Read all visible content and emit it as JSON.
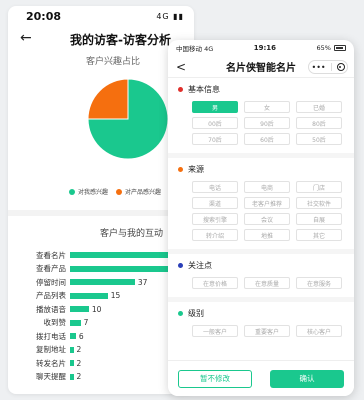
{
  "back_phone": {
    "status": {
      "time": "20:08",
      "signal": "4G"
    },
    "title": "我的访客-访客分析",
    "interest_title": "客户兴趣占比",
    "pie": {
      "slices": [
        {
          "label": "对我感兴趣",
          "value": 75,
          "color": "#1ac88e"
        },
        {
          "label": "对产品感兴趣",
          "value": 25,
          "color": "#f56f0f"
        }
      ]
    },
    "interaction_title": "客户与我的互动"
  },
  "chart_data": {
    "type": "bar",
    "categories": [
      "查看名片",
      "查看产品",
      "停留时间",
      "产品列表",
      "播放语音",
      "收到赞",
      "拨打电话",
      "复制地址",
      "转发名片",
      "聊天提醒"
    ],
    "values": [
      null,
      64,
      37,
      15,
      10,
      7,
      6,
      2,
      2,
      2
    ],
    "value_labels": [
      "",
      "64",
      "37",
      "15",
      "10",
      "7",
      "6",
      "2",
      "2",
      "2"
    ],
    "bar_fraction": [
      1.0,
      0.9,
      0.55,
      0.32,
      0.16,
      0.09,
      0.05,
      0.03,
      0.03,
      0.03
    ]
  },
  "front_phone": {
    "status": {
      "carrier": "中国移动",
      "network": "4G",
      "time": "19:16",
      "battery": "65%"
    },
    "title": "名片侠智能名片",
    "sections": [
      {
        "title": "基本信息",
        "dot_color": "#e0302c",
        "chips": [
          {
            "label": "男",
            "on": true
          },
          {
            "label": "女",
            "on": false
          },
          {
            "label": "已婚",
            "on": false
          },
          {
            "label": "00后",
            "on": false
          },
          {
            "label": "90后",
            "on": false
          },
          {
            "label": "80后",
            "on": false
          },
          {
            "label": "70后",
            "on": false
          },
          {
            "label": "60后",
            "on": false
          },
          {
            "label": "50后",
            "on": false
          }
        ]
      },
      {
        "title": "来源",
        "dot_color": "#f56f0f",
        "chips": [
          {
            "label": "电话",
            "on": false
          },
          {
            "label": "电商",
            "on": false
          },
          {
            "label": "门店",
            "on": false
          },
          {
            "label": "渠道",
            "on": false
          },
          {
            "label": "老客户推荐",
            "on": false
          },
          {
            "label": "社交软件",
            "on": false
          },
          {
            "label": "搜索引擎",
            "on": false
          },
          {
            "label": "会议",
            "on": false
          },
          {
            "label": "自展",
            "on": false
          },
          {
            "label": "转介绍",
            "on": false
          },
          {
            "label": "地推",
            "on": false
          },
          {
            "label": "其它",
            "on": false
          }
        ]
      },
      {
        "title": "关注点",
        "dot_color": "#2a3fb8",
        "chips": [
          {
            "label": "在意价格",
            "on": false
          },
          {
            "label": "在意质量",
            "on": false
          },
          {
            "label": "在意服务",
            "on": false
          }
        ]
      },
      {
        "title": "级别",
        "dot_color": "#1ac88e",
        "chips": [
          {
            "label": "一般客户",
            "on": false
          },
          {
            "label": "重要客户",
            "on": false
          },
          {
            "label": "核心客户",
            "on": false
          }
        ]
      }
    ],
    "footer": {
      "cancel_label": "暂不修改",
      "confirm_label": "确认"
    }
  }
}
